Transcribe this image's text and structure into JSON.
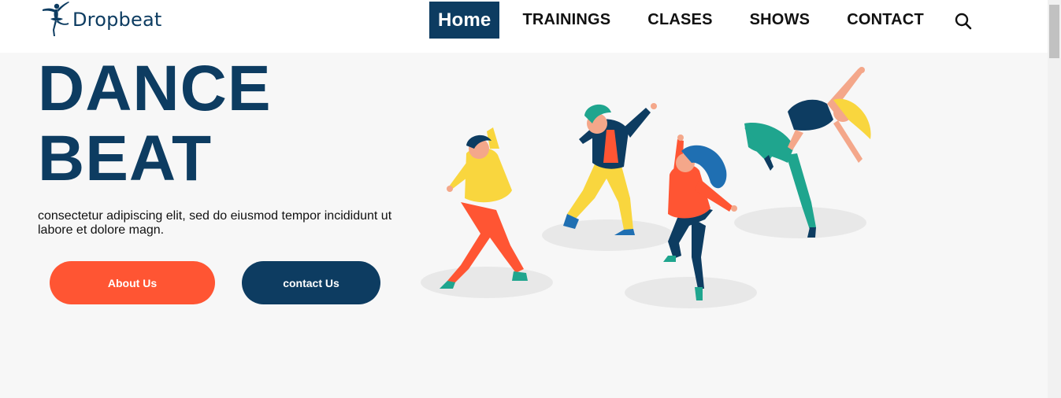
{
  "brand": {
    "name": "Dropbeat",
    "logo_icon": "ballerina-icon"
  },
  "nav": {
    "items": [
      {
        "label": "Home",
        "active": true
      },
      {
        "label": "TRAININGS",
        "active": false
      },
      {
        "label": "CLASES",
        "active": false
      },
      {
        "label": "SHOWS",
        "active": false
      },
      {
        "label": "CONTACT",
        "active": false
      }
    ],
    "search_icon": "search-icon"
  },
  "hero": {
    "title_line1": "DANCE",
    "title_line2": "BEAT",
    "description": "consectetur adipiscing elit, sed do eiusmod tempor incididunt ut labore et dolore magn.",
    "buttons": {
      "about": "About Us",
      "contact": "contact Us"
    },
    "illustration": "dancers-illustration"
  },
  "colors": {
    "brand": "#0d3c61",
    "accent": "#ff5533",
    "background": "#f7f7f7"
  }
}
